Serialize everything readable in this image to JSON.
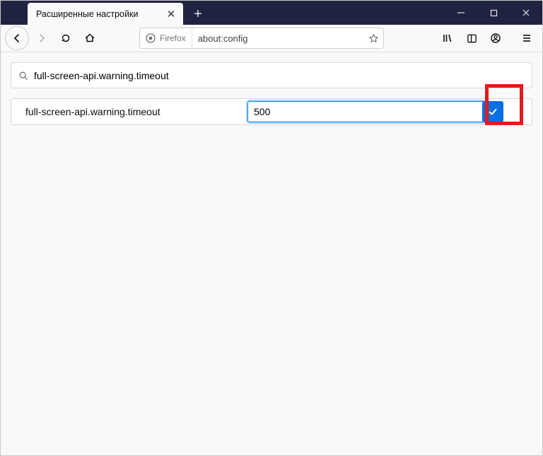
{
  "tab": {
    "title": "Расширенные настройки"
  },
  "urlbar": {
    "identity_label": "Firefox",
    "address": "about:config"
  },
  "search": {
    "value": "full-screen-api.warning.timeout"
  },
  "preference": {
    "name": "full-screen-api.warning.timeout",
    "value": "500"
  },
  "colors": {
    "highlight": "#e21b1b",
    "accent": "#0a6fe0"
  }
}
